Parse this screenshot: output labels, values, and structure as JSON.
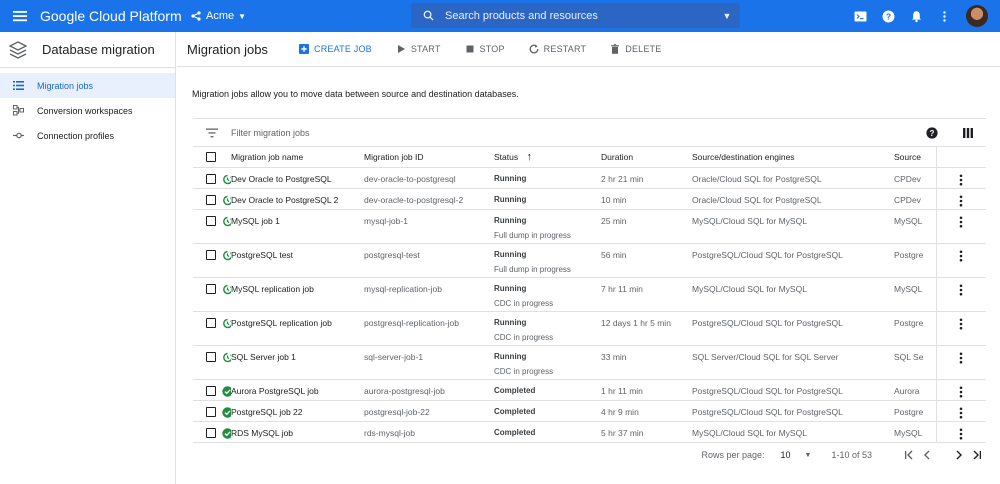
{
  "topbar": {
    "brand": "Google Cloud Platform",
    "project": "Acme",
    "search_placeholder": "Search products and resources",
    "icons": [
      "cloud-shell-icon",
      "help-icon",
      "notifications-icon",
      "avatar"
    ],
    "accent_color": "#1a73e8"
  },
  "sidebar": {
    "title": "Database migration",
    "items": [
      {
        "label": "Migration jobs",
        "icon": "list-icon",
        "active": true
      },
      {
        "label": "Conversion workspaces",
        "icon": "workspace-icon",
        "active": false
      },
      {
        "label": "Connection profiles",
        "icon": "connection-icon",
        "active": false
      }
    ]
  },
  "toolbar": {
    "title": "Migration jobs",
    "create": "CREATE JOB",
    "start": "START",
    "stop": "STOP",
    "restart": "RESTART",
    "delete": "DELETE"
  },
  "description": "Migration jobs allow you to move data between source and destination databases.",
  "filter": {
    "placeholder": "Filter migration jobs"
  },
  "table": {
    "headers": {
      "name": "Migration job name",
      "id": "Migration job ID",
      "status": "Status",
      "duration": "Duration",
      "engines": "Source/destination engines",
      "source": "Source"
    },
    "rows": [
      {
        "name": "Dev Oracle to PostgreSQL",
        "id": "dev-oracle-to-postgresql",
        "status": "Running",
        "sub": "",
        "duration": "2 hr 21 min",
        "engines": "Oracle/Cloud SQL for PostgreSQL",
        "source": "CPDev",
        "state": "running"
      },
      {
        "name": "Dev Oracle to PostgreSQL 2",
        "id": "dev-oracle-to-postgresql-2",
        "status": "Running",
        "sub": "",
        "duration": "10 min",
        "engines": "Oracle/Cloud SQL for PostgreSQL",
        "source": "CPDev",
        "state": "running"
      },
      {
        "name": "MySQL job 1",
        "id": "mysql-job-1",
        "status": "Running",
        "sub": "Full dump in progress",
        "duration": "25 min",
        "engines": "MySQL/Cloud SQL for MySQL",
        "source": "MySQL",
        "state": "running"
      },
      {
        "name": "PostgreSQL test",
        "id": "postgresql-test",
        "status": "Running",
        "sub": "Full dump in progress",
        "duration": "56 min",
        "engines": "PostgreSQL/Cloud SQL for PostgreSQL",
        "source": "Postgre",
        "state": "running"
      },
      {
        "name": "MySQL replication job",
        "id": "mysql-replication-job",
        "status": "Running",
        "sub": "CDC in progress",
        "duration": "7 hr 11 min",
        "engines": "MySQL/Cloud SQL for MySQL",
        "source": "MySQL",
        "state": "running"
      },
      {
        "name": "PostgreSQL replication job",
        "id": "postgresql-replication-job",
        "status": "Running",
        "sub": "CDC in progress",
        "duration": "12 days 1 hr 5 min",
        "engines": "PostgreSQL/Cloud SQL for PostgreSQL",
        "source": "Postgre",
        "state": "running"
      },
      {
        "name": "SQL Server job 1",
        "id": "sql-server-job-1",
        "status": "Running",
        "sub": "CDC in progress",
        "duration": "33 min",
        "engines": "SQL Server/Cloud SQL for SQL Server",
        "source": "SQL Se",
        "state": "running"
      },
      {
        "name": "Aurora PostgreSQL job",
        "id": "aurora-postgresql-job",
        "status": "Completed",
        "sub": "",
        "duration": "1 hr 11 min",
        "engines": "PostgreSQL/Cloud SQL for PostgreSQL",
        "source": "Aurora",
        "state": "completed"
      },
      {
        "name": "PostgreSQL job 22",
        "id": "postgresql-job-22",
        "status": "Completed",
        "sub": "",
        "duration": "4 hr 9 min",
        "engines": "PostgreSQL/Cloud SQL for PostgreSQL",
        "source": "Postgre",
        "state": "completed"
      },
      {
        "name": "RDS MySQL job",
        "id": "rds-mysql-job",
        "status": "Completed",
        "sub": "",
        "duration": "5 hr 37 min",
        "engines": "MySQL/Cloud SQL for MySQL",
        "source": "MySQL",
        "state": "completed"
      }
    ]
  },
  "pager": {
    "rows_per_page_label": "Rows per page:",
    "rows_per_page": "10",
    "range": "1-10 of 53"
  },
  "colors": {
    "running": "#1e8e3e",
    "completed": "#1e8e3e",
    "active_nav_bg": "#e8f0fe"
  }
}
